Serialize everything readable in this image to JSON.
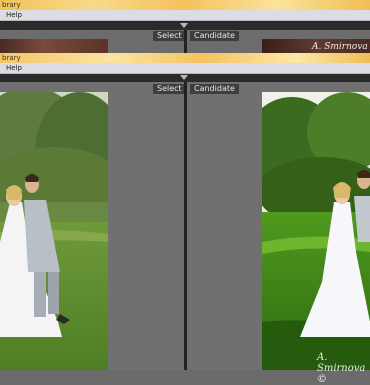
{
  "top_window": {
    "title": "brary",
    "menu_help": "Help",
    "select_label": "Select",
    "candidate_label": "Candidate",
    "watermark": "A. Smirnova"
  },
  "window": {
    "title": "brary",
    "menu_help": "Help",
    "select_label": "Select",
    "candidate_label": "Candidate",
    "watermark": "A. Smirnova ©"
  },
  "colors": {
    "panel_bg": "#707070",
    "tag_bg": "#3e3e3e",
    "title_accent": "#f4c666"
  },
  "icons": {
    "toggle": "triangle-down-icon"
  }
}
